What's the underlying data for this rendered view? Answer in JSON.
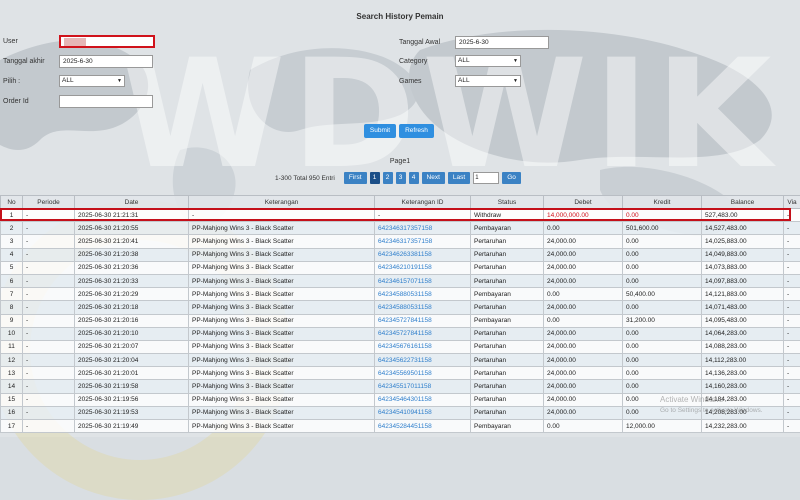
{
  "page": {
    "title": "Search History Pemain"
  },
  "form": {
    "user_label": "User",
    "user_value": "",
    "tanggal_awal_label": "Tanggal Awal",
    "tanggal_awal_value": "2025-6-30",
    "tanggal_akhir_label": "Tanggal akhir",
    "tanggal_akhir_value": "2025-6-30",
    "category_label": "Category",
    "category_value": "ALL",
    "pilih_label": "Pilih  :",
    "pilih_value": "ALL",
    "games_label": "Games",
    "games_value": "ALL",
    "order_id_label": "Order Id",
    "order_id_value": ""
  },
  "buttons": {
    "submit": "Submit",
    "refresh": "Refresh"
  },
  "pager": {
    "label": "Page1",
    "info": "1-300 Total 950 Entri",
    "first": "First",
    "pages": [
      "1",
      "2",
      "3",
      "4"
    ],
    "next": "Next",
    "last": "Last",
    "goto_value": "1",
    "go": "Go"
  },
  "table": {
    "headers": [
      "No",
      "Periode",
      "Date",
      "Keterangan",
      "Keterangan ID",
      "Status",
      "Debet",
      "Kredit",
      "Balance",
      "Via"
    ],
    "rows": [
      {
        "no": "1",
        "periode": "-",
        "date": "2025-06-30 21:21:31",
        "keterangan": "-",
        "ket_id": "-",
        "status": "Withdraw",
        "debet": "14,000,000.00",
        "kredit": "0.00",
        "balance": "527,483.00",
        "via": "-"
      },
      {
        "no": "2",
        "periode": "-",
        "date": "2025-06-30 21:20:55",
        "keterangan": "PP-Mahjong Wins 3 - Black Scatter",
        "ket_id": "642346317357158",
        "status": "Pembayaran",
        "debet": "0.00",
        "kredit": "501,600.00",
        "balance": "14,527,483.00",
        "via": "-"
      },
      {
        "no": "3",
        "periode": "-",
        "date": "2025-06-30 21:20:41",
        "keterangan": "PP-Mahjong Wins 3 - Black Scatter",
        "ket_id": "642346317357158",
        "status": "Pertaruhan",
        "debet": "24,000.00",
        "kredit": "0.00",
        "balance": "14,025,883.00",
        "via": "-"
      },
      {
        "no": "4",
        "periode": "-",
        "date": "2025-06-30 21:20:38",
        "keterangan": "PP-Mahjong Wins 3 - Black Scatter",
        "ket_id": "642346263381158",
        "status": "Pertaruhan",
        "debet": "24,000.00",
        "kredit": "0.00",
        "balance": "14,049,883.00",
        "via": "-"
      },
      {
        "no": "5",
        "periode": "-",
        "date": "2025-06-30 21:20:36",
        "keterangan": "PP-Mahjong Wins 3 - Black Scatter",
        "ket_id": "642346210191158",
        "status": "Pertaruhan",
        "debet": "24,000.00",
        "kredit": "0.00",
        "balance": "14,073,883.00",
        "via": "-"
      },
      {
        "no": "6",
        "periode": "-",
        "date": "2025-06-30 21:20:33",
        "keterangan": "PP-Mahjong Wins 3 - Black Scatter",
        "ket_id": "642346157071158",
        "status": "Pertaruhan",
        "debet": "24,000.00",
        "kredit": "0.00",
        "balance": "14,097,883.00",
        "via": "-"
      },
      {
        "no": "7",
        "periode": "-",
        "date": "2025-06-30 21:20:29",
        "keterangan": "PP-Mahjong Wins 3 - Black Scatter",
        "ket_id": "642345880531158",
        "status": "Pembayaran",
        "debet": "0.00",
        "kredit": "50,400.00",
        "balance": "14,121,883.00",
        "via": "-"
      },
      {
        "no": "8",
        "periode": "-",
        "date": "2025-06-30 21:20:18",
        "keterangan": "PP-Mahjong Wins 3 - Black Scatter",
        "ket_id": "642345880531158",
        "status": "Pertaruhan",
        "debet": "24,000.00",
        "kredit": "0.00",
        "balance": "14,071,483.00",
        "via": "-"
      },
      {
        "no": "9",
        "periode": "-",
        "date": "2025-06-30 21:20:16",
        "keterangan": "PP-Mahjong Wins 3 - Black Scatter",
        "ket_id": "642345727841158",
        "status": "Pembayaran",
        "debet": "0.00",
        "kredit": "31,200.00",
        "balance": "14,095,483.00",
        "via": "-"
      },
      {
        "no": "10",
        "periode": "-",
        "date": "2025-06-30 21:20:10",
        "keterangan": "PP-Mahjong Wins 3 - Black Scatter",
        "ket_id": "642345727841158",
        "status": "Pertaruhan",
        "debet": "24,000.00",
        "kredit": "0.00",
        "balance": "14,064,283.00",
        "via": "-"
      },
      {
        "no": "11",
        "periode": "-",
        "date": "2025-06-30 21:20:07",
        "keterangan": "PP-Mahjong Wins 3 - Black Scatter",
        "ket_id": "642345676161158",
        "status": "Pertaruhan",
        "debet": "24,000.00",
        "kredit": "0.00",
        "balance": "14,088,283.00",
        "via": "-"
      },
      {
        "no": "12",
        "periode": "-",
        "date": "2025-06-30 21:20:04",
        "keterangan": "PP-Mahjong Wins 3 - Black Scatter",
        "ket_id": "642345622731158",
        "status": "Pertaruhan",
        "debet": "24,000.00",
        "kredit": "0.00",
        "balance": "14,112,283.00",
        "via": "-"
      },
      {
        "no": "13",
        "periode": "-",
        "date": "2025-06-30 21:20:01",
        "keterangan": "PP-Mahjong Wins 3 - Black Scatter",
        "ket_id": "642345569501158",
        "status": "Pertaruhan",
        "debet": "24,000.00",
        "kredit": "0.00",
        "balance": "14,136,283.00",
        "via": "-"
      },
      {
        "no": "14",
        "periode": "-",
        "date": "2025-06-30 21:19:58",
        "keterangan": "PP-Mahjong Wins 3 - Black Scatter",
        "ket_id": "642345517011158",
        "status": "Pertaruhan",
        "debet": "24,000.00",
        "kredit": "0.00",
        "balance": "14,160,283.00",
        "via": "-"
      },
      {
        "no": "15",
        "periode": "-",
        "date": "2025-06-30 21:19:56",
        "keterangan": "PP-Mahjong Wins 3 - Black Scatter",
        "ket_id": "642345464301158",
        "status": "Pertaruhan",
        "debet": "24,000.00",
        "kredit": "0.00",
        "balance": "14,184,283.00",
        "via": "-"
      },
      {
        "no": "16",
        "periode": "-",
        "date": "2025-06-30 21:19:53",
        "keterangan": "PP-Mahjong Wins 3 - Black Scatter",
        "ket_id": "642345410941158",
        "status": "Pertaruhan",
        "debet": "24,000.00",
        "kredit": "0.00",
        "balance": "14,208,283.00",
        "via": "-"
      },
      {
        "no": "17",
        "periode": "-",
        "date": "2025-06-30 21:19:49",
        "keterangan": "PP-Mahjong Wins 3 - Black Scatter",
        "ket_id": "642345284451158",
        "status": "Pembayaran",
        "debet": "0.00",
        "kredit": "12,000.00",
        "balance": "14,232,283.00",
        "via": "-"
      }
    ]
  },
  "watermark": {
    "text": "WDWIK"
  },
  "activate": {
    "line1": "Activate Windows",
    "line2": "Go to Settings to activate Windows."
  },
  "colors": {
    "accent": "#2f8fe0",
    "pager": "#3b82c4",
    "highlight": "#d0121b",
    "link": "#2f7fcc"
  }
}
